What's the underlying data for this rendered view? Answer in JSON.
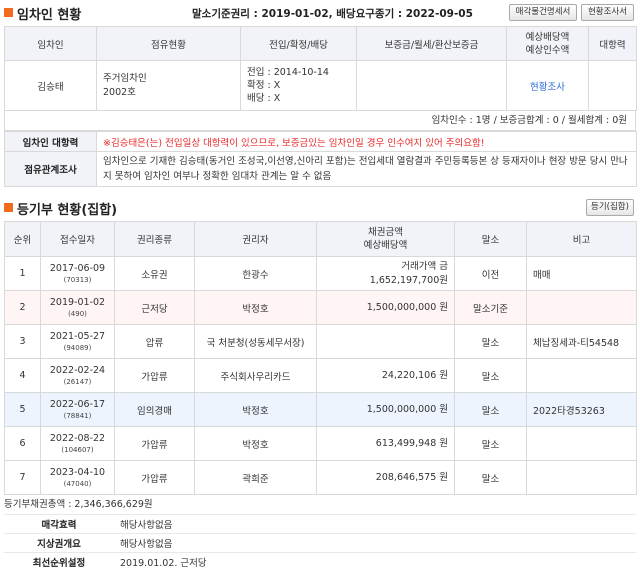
{
  "tenant": {
    "title": "임차인 현황",
    "info": "말소기준권리 : 2019-01-02, 배당요구종기 : 2022-09-05",
    "btn_sale": "매각물건명세서",
    "btn_survey": "현황조사서",
    "headers": [
      "임차인",
      "점유현황",
      "전입/확정/배당",
      "보증금/월세/환산보증금",
      "예상배당액",
      "예상인수액",
      "대항력"
    ],
    "row": {
      "name": "김승태",
      "occupancy_1": "주거임차인",
      "occupancy_2": "2002호",
      "dates_1": "전입 : 2014-10-14",
      "dates_2": "확정 : X",
      "dates_3": "배당 : X",
      "deposit": "",
      "expected": "현황조사",
      "opposing": ""
    },
    "summary": "임차인수 : 1명 / 보증금합계 : 0 / 월세합계 : 0원",
    "opposing_label": "임차인 대항력",
    "opposing_text": "※김승태은(는) 전입일상 대항력이 있으므로, 보증금있는 임차인일 경우 인수여지 있어 주의요함!",
    "investigation_label": "점유관계조사",
    "investigation_text": "임차인으로 기재한 김승태(동거인 조성국,이선영,신아리 포함)는 전입세대 열람결과 주민등록등본 상 등재자이나 현장 방문 당시 만나지 못하여 임차인 여부나 정확한 임대차 관계는 알 수 없음"
  },
  "registry": {
    "title": "등기부 현황(집합)",
    "btn": "등기(집합)",
    "headers": [
      "순위",
      "접수일자",
      "권리종류",
      "권리자",
      "채권금액",
      "예상배당액",
      "말소",
      "비고"
    ],
    "rows": [
      {
        "rank": "1",
        "date": "2017-06-09",
        "no": "(70313)",
        "type": "소유권",
        "holder": "한광수",
        "amount_1": "거래가액 금",
        "amount_2": "1,652,197,700원",
        "status": "이전",
        "note": "매매"
      },
      {
        "rank": "2",
        "date": "2019-01-02",
        "no": "(490)",
        "type": "근저당",
        "holder": "박정호",
        "amount_1": "1,500,000,000 원",
        "amount_2": "",
        "status": "말소기준",
        "note": ""
      },
      {
        "rank": "3",
        "date": "2021-05-27",
        "no": "(94089)",
        "type": "압류",
        "holder": "국 처분청(성동세무서장)",
        "amount_1": "",
        "amount_2": "",
        "status": "말소",
        "note": "체납징세과-티54548"
      },
      {
        "rank": "4",
        "date": "2022-02-24",
        "no": "(26147)",
        "type": "가압류",
        "holder": "주식회사우리카드",
        "amount_1": "24,220,106 원",
        "amount_2": "",
        "status": "말소",
        "note": ""
      },
      {
        "rank": "5",
        "date": "2022-06-17",
        "no": "(78841)",
        "type": "임의경매",
        "holder": "박정호",
        "amount_1": "1,500,000,000 원",
        "amount_2": "",
        "status": "말소",
        "note": "2022타경53263"
      },
      {
        "rank": "6",
        "date": "2022-08-22",
        "no": "(104607)",
        "type": "가압류",
        "holder": "박정호",
        "amount_1": "613,499,948 원",
        "amount_2": "",
        "status": "말소",
        "note": ""
      },
      {
        "rank": "7",
        "date": "2023-04-10",
        "no": "(47040)",
        "type": "가압류",
        "holder": "곽희준",
        "amount_1": "208,646,575 원",
        "amount_2": "",
        "status": "말소",
        "note": ""
      }
    ],
    "total": "등기부채권총액 : 2,346,366,629원",
    "extra": [
      {
        "label": "매각효력",
        "value": "해당사항없음"
      },
      {
        "label": "지상권개요",
        "value": "해당사항없음"
      },
      {
        "label": "최선순위설정",
        "value": "2019.01.02. 근저당"
      }
    ]
  }
}
